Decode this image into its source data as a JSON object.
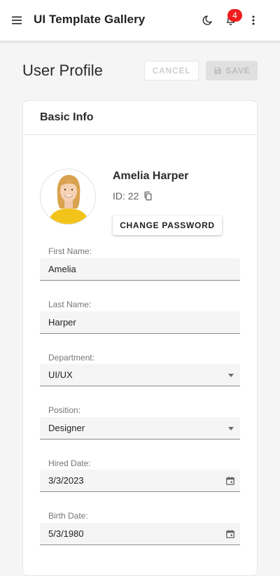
{
  "app": {
    "title": "UI Template Gallery",
    "notification_count": "4",
    "icons": {
      "menu": "menu-icon",
      "theme": "moon-icon",
      "notifications": "bell-icon",
      "more": "more-vert-icon"
    }
  },
  "page": {
    "title": "User Profile",
    "cancel_label": "CANCEL",
    "save_label": "SAVE"
  },
  "card": {
    "title": "Basic Info"
  },
  "user": {
    "name": "Amelia Harper",
    "id_text": "ID: 22",
    "change_password_label": "CHANGE PASSWORD"
  },
  "fields": {
    "first_name": {
      "label": "First Name:",
      "value": "Amelia"
    },
    "last_name": {
      "label": "Last Name:",
      "value": "Harper"
    },
    "department": {
      "label": "Department:",
      "value": "UI/UX"
    },
    "position": {
      "label": "Position:",
      "value": "Designer"
    },
    "hired_date": {
      "label": "Hired Date:",
      "value": "3/3/2023"
    },
    "birth_date": {
      "label": "Birth Date:",
      "value": "5/3/1980"
    }
  },
  "colors": {
    "badge": "#f01e1e",
    "avatar_shirt": "#f2c318",
    "avatar_hair": "#d9a24e"
  }
}
